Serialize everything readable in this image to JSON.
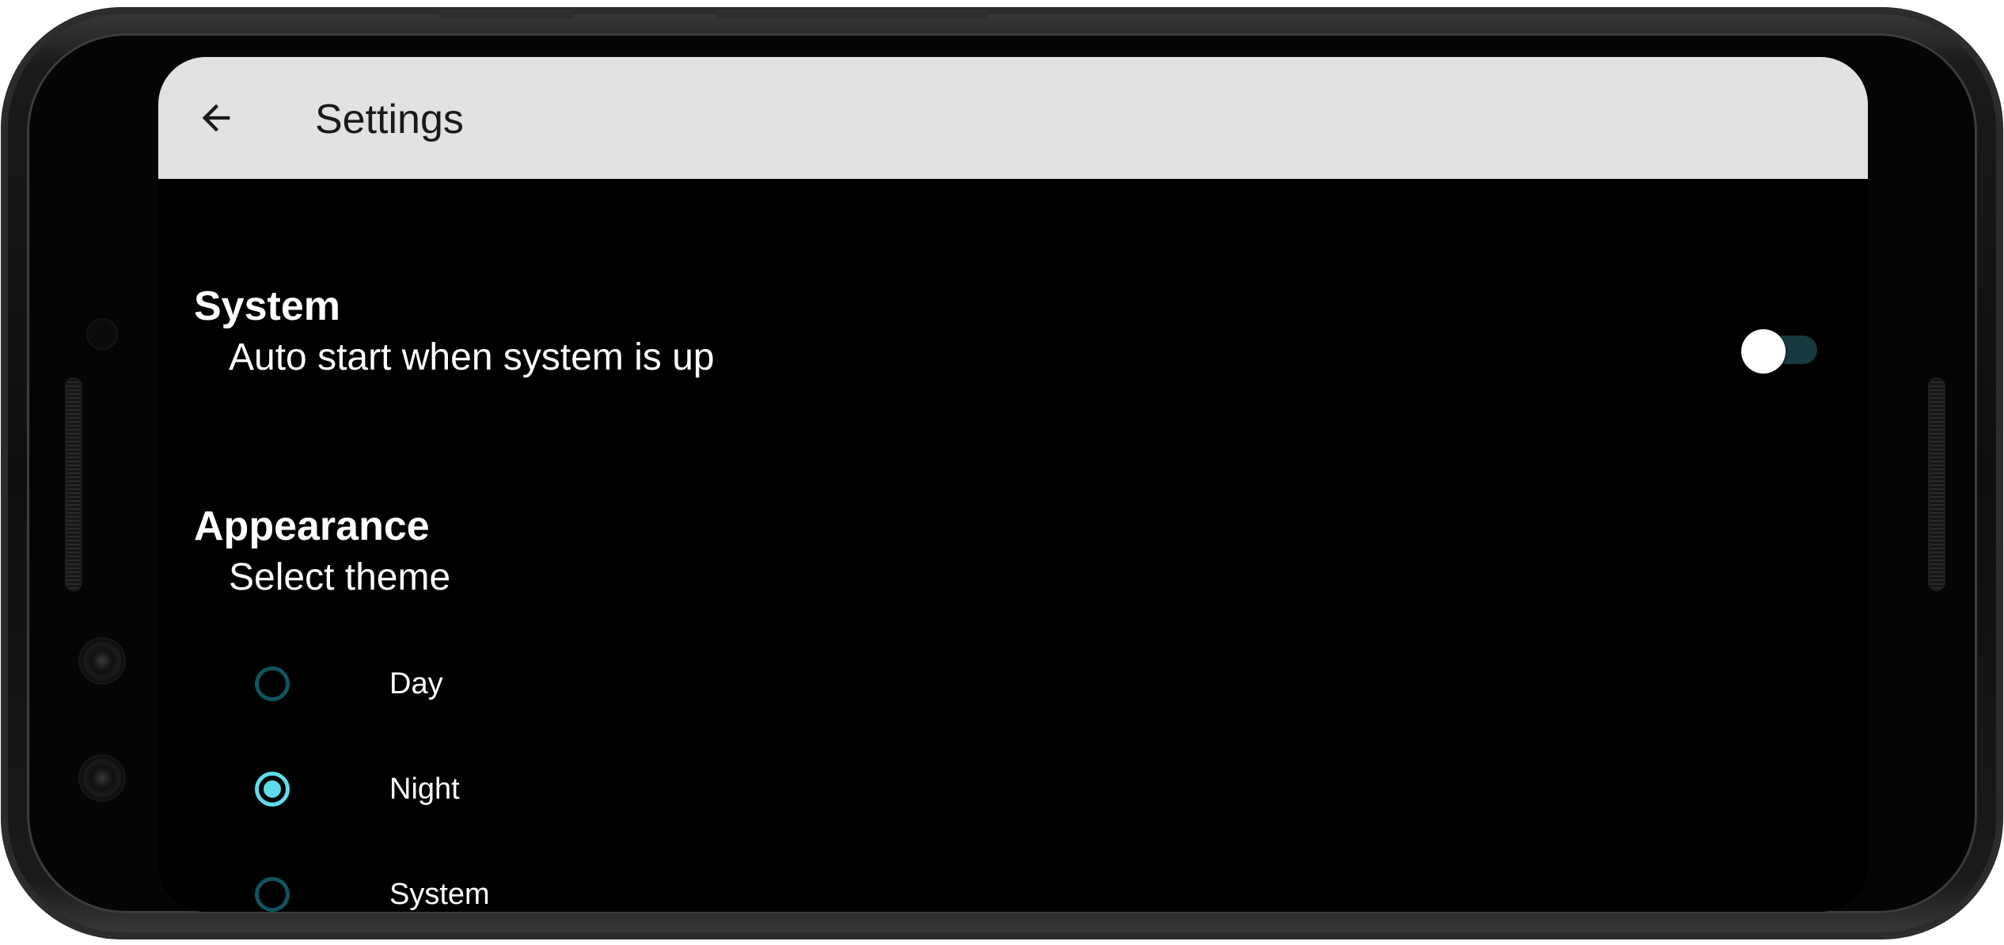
{
  "app_bar": {
    "title": "Settings",
    "back_icon": "arrow-back-icon"
  },
  "sections": {
    "system": {
      "header": "System",
      "auto_start": {
        "label": "Auto start when system is up",
        "enabled": false
      }
    },
    "appearance": {
      "header": "Appearance",
      "theme_label": "Select theme",
      "options": [
        {
          "label": "Day",
          "selected": false
        },
        {
          "label": "Night",
          "selected": true
        },
        {
          "label": "System",
          "selected": false
        }
      ]
    }
  },
  "colors": {
    "app_bar_bg": "#e3e1e2",
    "screen_bg": "#000000",
    "accent": "#5fdcec",
    "radio_unselected": "#0f5560",
    "switch_track_off": "#163a40",
    "switch_thumb_off": "#ffffff"
  }
}
